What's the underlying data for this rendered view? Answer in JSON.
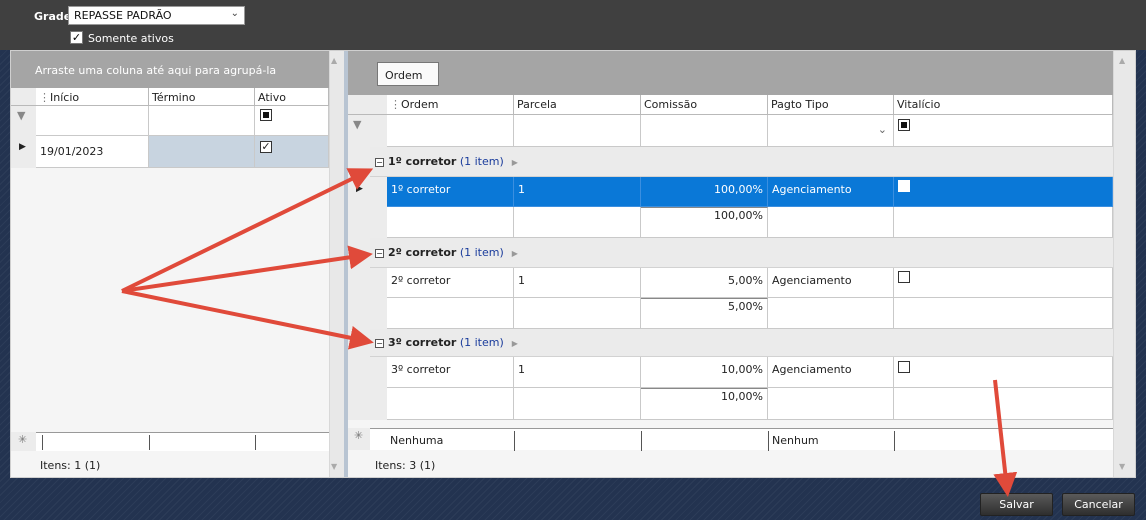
{
  "top": {
    "grade_label": "Grade",
    "grade_value": "REPASSE PADRÃO",
    "somente_ativos": "Somente ativos"
  },
  "left": {
    "group_hint": "Arraste uma coluna até aqui para agrupá-la",
    "columns": [
      "Início",
      "Término",
      "Ativo"
    ],
    "row": {
      "inicio": "19/01/2023"
    },
    "footer": "Itens: 1 (1)"
  },
  "right": {
    "ordem_chip": "Ordem",
    "columns": [
      "Ordem",
      "Parcela",
      "Comissão",
      "Pagto Tipo",
      "Vitalício"
    ],
    "groups": [
      {
        "name": "1º corretor",
        "count": "(1 item)",
        "ordem": "1º corretor",
        "parcela": "1",
        "comissao": "100,00%",
        "pagto": "Agenciamento",
        "total": "100,00%"
      },
      {
        "name": "2º corretor",
        "count": "(1 item)",
        "ordem": "2º corretor",
        "parcela": "1",
        "comissao": "5,00%",
        "pagto": "Agenciamento",
        "total": "5,00%"
      },
      {
        "name": "3º corretor",
        "count": "(1 item)",
        "ordem": "3º corretor",
        "parcela": "1",
        "comissao": "10,00%",
        "pagto": "Agenciamento",
        "total": "10,00%"
      }
    ],
    "new_row": {
      "ordem": "Nenhuma",
      "pagto": "Nenhum"
    },
    "footer": "Itens: 3 (1)"
  },
  "buttons": {
    "salvar": "Salvar",
    "cancelar": "Cancelar"
  },
  "colors": {
    "selected_row": "#0a78d7",
    "annotation_arrow": "#e04a3a",
    "top_bar": "#404040"
  }
}
